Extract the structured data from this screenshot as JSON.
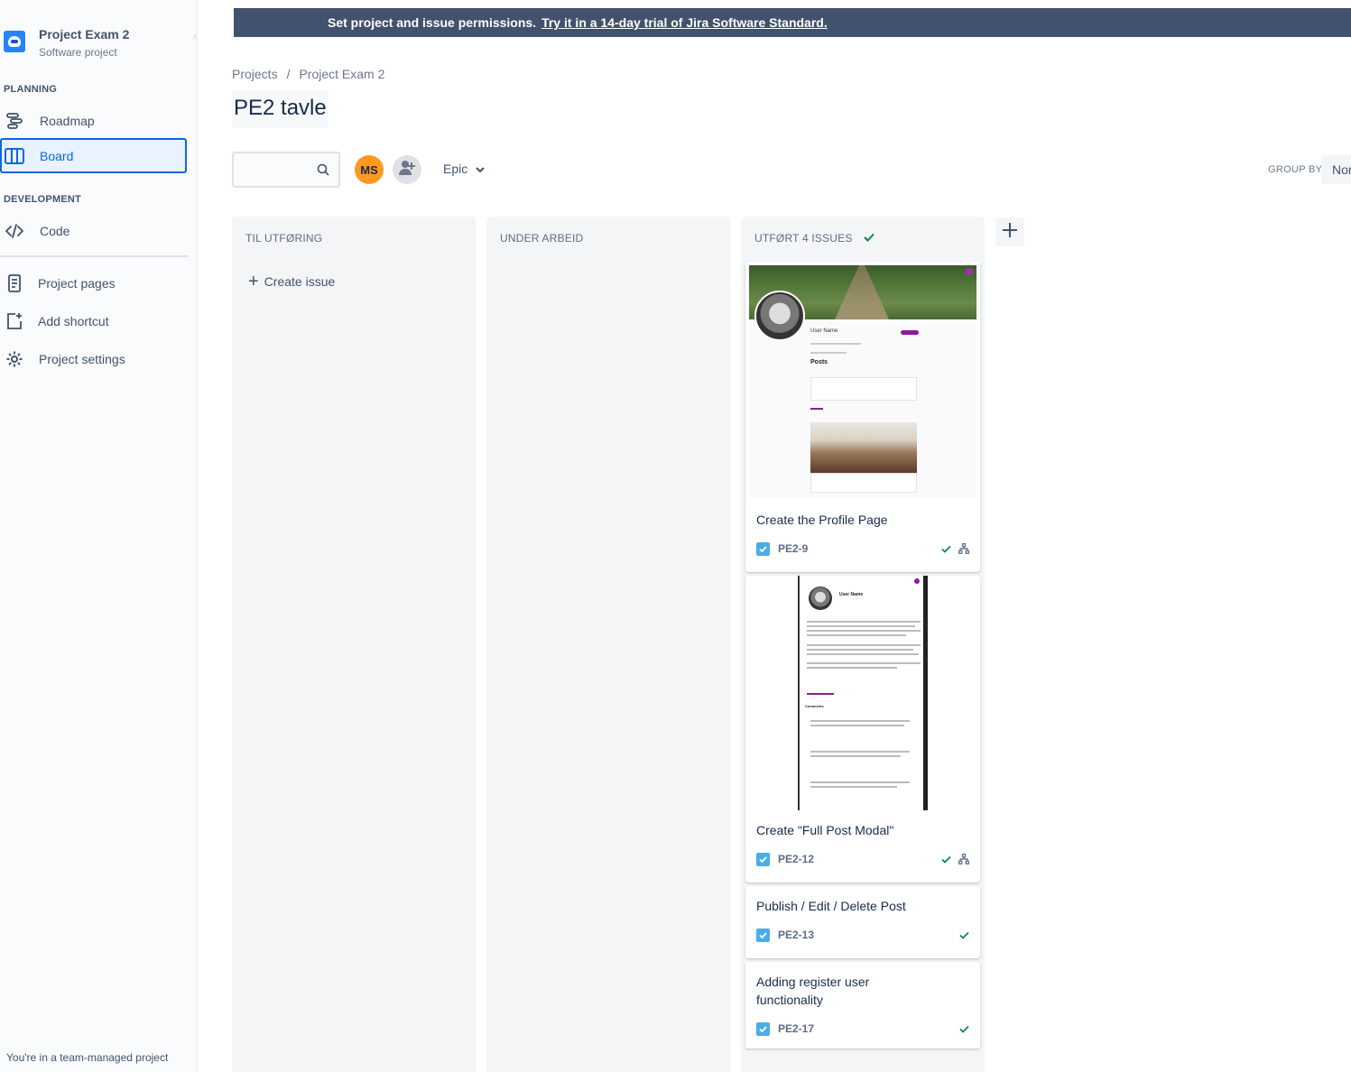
{
  "project": {
    "name": "Project Exam 2",
    "type": "Software project"
  },
  "sidebar": {
    "planning_label": "PLANNING",
    "development_label": "DEVELOPMENT",
    "items": [
      {
        "label": "Roadmap",
        "icon": "roadmap-icon"
      },
      {
        "label": "Board",
        "icon": "board-icon",
        "active": true
      },
      {
        "label": "Code",
        "icon": "code-icon"
      },
      {
        "label": "Project pages",
        "icon": "page-icon"
      },
      {
        "label": "Add shortcut",
        "icon": "add-shortcut-icon"
      },
      {
        "label": "Project settings",
        "icon": "gear-icon"
      }
    ],
    "footer": "You're in a team-managed project"
  },
  "banner": {
    "text": "Set project and issue permissions.",
    "link": "Try it in a 14-day trial of Jira Software Standard."
  },
  "breadcrumb": [
    "Projects",
    "Project Exam 2"
  ],
  "page_title": "PE2 tavle",
  "toolbar": {
    "avatar_initials": "MS",
    "epic_label": "Epic",
    "group_by_label": "GROUP BY",
    "group_by_value": "None"
  },
  "columns": [
    {
      "title": "TIL UTFØRING",
      "create_label": "Create issue"
    },
    {
      "title": "UNDER ARBEID"
    },
    {
      "title": "UTFØRT 4 ISSUES"
    }
  ],
  "cards": [
    {
      "title": "Create the Profile Page",
      "key": "PE2-9",
      "thumb": {
        "user_name": "User Name",
        "posts_heading": "Posts"
      }
    },
    {
      "title": "Create \"Full Post Modal\"",
      "key": "PE2-12",
      "thumb": {
        "user_name": "User Name",
        "comments_heading": "Comments"
      }
    },
    {
      "title": "Publish / Edit / Delete Post",
      "key": "PE2-13"
    },
    {
      "title": "Adding register user functionality",
      "key": "PE2-17"
    }
  ],
  "colors": {
    "accent": "#0c66e4",
    "banner_bg": "#42526e",
    "avatar_ms": "#ff991f",
    "done_check": "#00875a",
    "task_icon": "#4bade8"
  }
}
